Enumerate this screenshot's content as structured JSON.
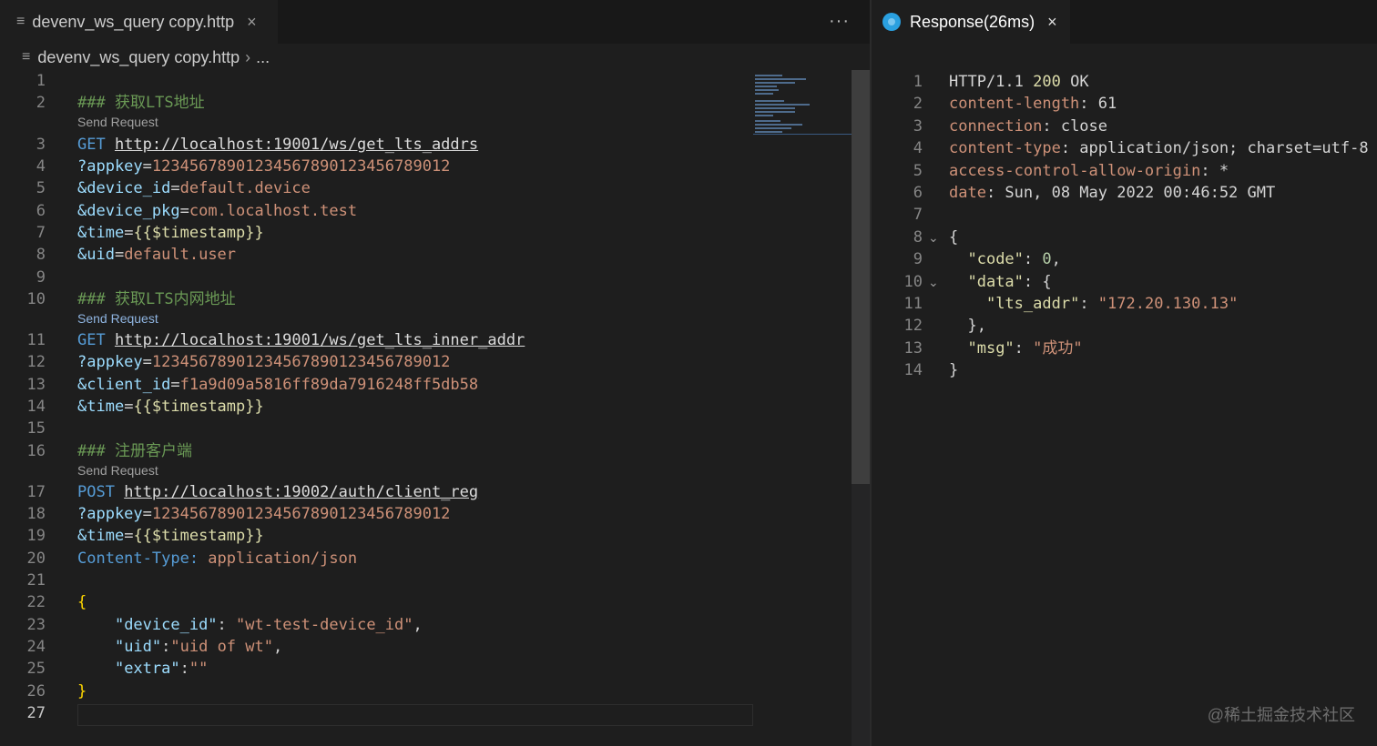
{
  "left_tab": {
    "filename": "devenv_ws_query copy.http",
    "icon": "lines-icon",
    "more": "···"
  },
  "breadcrumb": {
    "file": "devenv_ws_query copy.http",
    "rest": "..."
  },
  "code_lens": "Send Request",
  "editor_lines": [
    {
      "n": "1",
      "segs": []
    },
    {
      "n": "2",
      "segs": [
        [
          "c-comment",
          "### 获取LTS地址"
        ]
      ]
    },
    {
      "n": "3",
      "segs": [
        [
          "c-method",
          "GET "
        ],
        [
          "c-url",
          "http://localhost:19001/ws/get_lts_addrs"
        ]
      ]
    },
    {
      "n": "4",
      "segs": [
        [
          "c-key",
          "?appkey"
        ],
        [
          "c-plain",
          "="
        ],
        [
          "c-val",
          "12345678901234567890123456789012"
        ]
      ]
    },
    {
      "n": "5",
      "segs": [
        [
          "c-key",
          "&device_id"
        ],
        [
          "c-plain",
          "="
        ],
        [
          "c-val",
          "default.device"
        ]
      ]
    },
    {
      "n": "6",
      "segs": [
        [
          "c-key",
          "&device_pkg"
        ],
        [
          "c-plain",
          "="
        ],
        [
          "c-val",
          "com.localhost.test"
        ]
      ]
    },
    {
      "n": "7",
      "segs": [
        [
          "c-key",
          "&time"
        ],
        [
          "c-plain",
          "="
        ],
        [
          "c-var",
          "{{$timestamp}}"
        ]
      ]
    },
    {
      "n": "8",
      "segs": [
        [
          "c-key",
          "&uid"
        ],
        [
          "c-plain",
          "="
        ],
        [
          "c-val",
          "default.user"
        ]
      ]
    },
    {
      "n": "9",
      "segs": []
    },
    {
      "n": "10",
      "segs": [
        [
          "c-comment",
          "### 获取LTS内网地址"
        ]
      ]
    },
    {
      "n": "11",
      "segs": [
        [
          "c-method",
          "GET "
        ],
        [
          "c-url",
          "http://localhost:19001/ws/get_lts_inner_addr"
        ]
      ]
    },
    {
      "n": "12",
      "segs": [
        [
          "c-key",
          "?appkey"
        ],
        [
          "c-plain",
          "="
        ],
        [
          "c-val",
          "12345678901234567890123456789012"
        ]
      ]
    },
    {
      "n": "13",
      "segs": [
        [
          "c-key",
          "&client_id"
        ],
        [
          "c-plain",
          "="
        ],
        [
          "c-val",
          "f1a9d09a5816ff89da7916248ff5db58"
        ]
      ]
    },
    {
      "n": "14",
      "segs": [
        [
          "c-key",
          "&time"
        ],
        [
          "c-plain",
          "="
        ],
        [
          "c-var",
          "{{$timestamp}}"
        ]
      ]
    },
    {
      "n": "15",
      "segs": []
    },
    {
      "n": "16",
      "segs": [
        [
          "c-comment",
          "### 注册客户端"
        ]
      ]
    },
    {
      "n": "17",
      "segs": [
        [
          "c-method",
          "POST "
        ],
        [
          "c-url",
          "http://localhost:19002/auth/client_reg"
        ]
      ]
    },
    {
      "n": "18",
      "segs": [
        [
          "c-key",
          "?appkey"
        ],
        [
          "c-plain",
          "="
        ],
        [
          "c-val",
          "12345678901234567890123456789012"
        ]
      ]
    },
    {
      "n": "19",
      "segs": [
        [
          "c-key",
          "&time"
        ],
        [
          "c-plain",
          "="
        ],
        [
          "c-var",
          "{{$timestamp}}"
        ]
      ]
    },
    {
      "n": "20",
      "segs": [
        [
          "c-method",
          "Content-Type: "
        ],
        [
          "c-val",
          "application/json"
        ]
      ]
    },
    {
      "n": "21",
      "segs": []
    },
    {
      "n": "22",
      "segs": [
        [
          "c-brace",
          "{"
        ]
      ]
    },
    {
      "n": "23",
      "segs": [
        [
          "c-plain",
          "    "
        ],
        [
          "c-key",
          "\"device_id\""
        ],
        [
          "c-plain",
          ": "
        ],
        [
          "c-val",
          "\"wt-test-device_id\""
        ],
        [
          "c-plain",
          ","
        ]
      ]
    },
    {
      "n": "24",
      "segs": [
        [
          "c-plain",
          "    "
        ],
        [
          "c-key",
          "\"uid\""
        ],
        [
          "c-plain",
          ":"
        ],
        [
          "c-val",
          "\"uid of wt\""
        ],
        [
          "c-plain",
          ","
        ]
      ]
    },
    {
      "n": "25",
      "segs": [
        [
          "c-plain",
          "    "
        ],
        [
          "c-key",
          "\"extra\""
        ],
        [
          "c-plain",
          ":"
        ],
        [
          "c-val",
          "\"\""
        ]
      ]
    },
    {
      "n": "26",
      "segs": [
        [
          "c-brace",
          "}"
        ]
      ]
    },
    {
      "n": "27",
      "segs": []
    }
  ],
  "right_tab": {
    "title": "Response(26ms)"
  },
  "response_lines": [
    {
      "n": "1",
      "fold": "",
      "segs": [
        [
          "c-plain",
          "HTTP/1.1 "
        ],
        [
          "h-status",
          "200"
        ],
        [
          "c-plain",
          " OK"
        ]
      ]
    },
    {
      "n": "2",
      "fold": "",
      "segs": [
        [
          "h-name",
          "content-length"
        ],
        [
          "c-plain",
          ": 61"
        ]
      ]
    },
    {
      "n": "3",
      "fold": "",
      "segs": [
        [
          "h-name",
          "connection"
        ],
        [
          "c-plain",
          ": close"
        ]
      ]
    },
    {
      "n": "4",
      "fold": "",
      "segs": [
        [
          "h-name",
          "content-type"
        ],
        [
          "c-plain",
          ": application/json; charset=utf-8"
        ]
      ]
    },
    {
      "n": "5",
      "fold": "",
      "segs": [
        [
          "h-name",
          "access-control-allow-origin"
        ],
        [
          "c-plain",
          ": *"
        ]
      ]
    },
    {
      "n": "6",
      "fold": "",
      "segs": [
        [
          "h-name",
          "date"
        ],
        [
          "c-plain",
          ": Sun, 08 May 2022 00:46:52 GMT"
        ]
      ]
    },
    {
      "n": "7",
      "fold": "",
      "segs": []
    },
    {
      "n": "8",
      "fold": "⌄",
      "segs": [
        [
          "c-plain",
          "{"
        ]
      ]
    },
    {
      "n": "9",
      "fold": "",
      "segs": [
        [
          "c-plain",
          "  "
        ],
        [
          "j-key",
          "\"code\""
        ],
        [
          "c-plain",
          ": "
        ],
        [
          "j-num",
          "0"
        ],
        [
          "c-plain",
          ","
        ]
      ]
    },
    {
      "n": "10",
      "fold": "⌄",
      "segs": [
        [
          "c-plain",
          "  "
        ],
        [
          "j-key",
          "\"data\""
        ],
        [
          "c-plain",
          ": {"
        ]
      ]
    },
    {
      "n": "11",
      "fold": "",
      "segs": [
        [
          "c-plain",
          "    "
        ],
        [
          "j-key",
          "\"lts_addr\""
        ],
        [
          "c-plain",
          ": "
        ],
        [
          "j-str",
          "\"172.20.130.13\""
        ]
      ]
    },
    {
      "n": "12",
      "fold": "",
      "segs": [
        [
          "c-plain",
          "  },"
        ]
      ]
    },
    {
      "n": "13",
      "fold": "",
      "segs": [
        [
          "c-plain",
          "  "
        ],
        [
          "j-key",
          "\"msg\""
        ],
        [
          "c-plain",
          ": "
        ],
        [
          "j-str",
          "\"成功\""
        ]
      ]
    },
    {
      "n": "14",
      "fold": "",
      "segs": [
        [
          "c-plain",
          "}"
        ]
      ]
    }
  ],
  "watermark": "@稀土掘金技术社区"
}
